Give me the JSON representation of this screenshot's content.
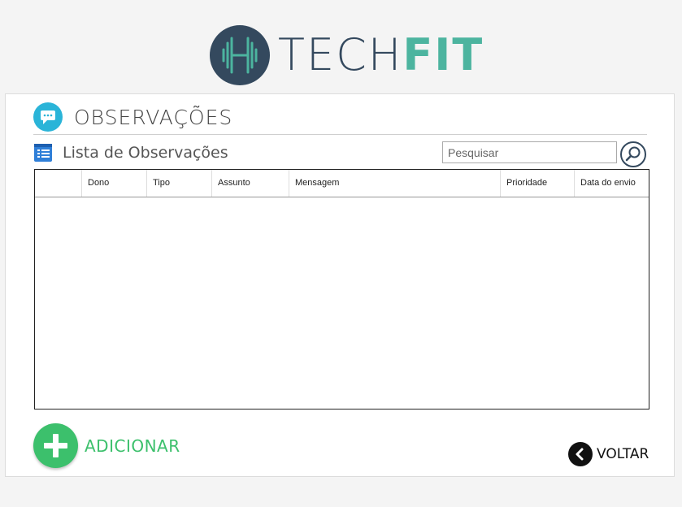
{
  "brand": {
    "tech": "TECH",
    "fit": "FIT",
    "colors": {
      "dark": "#34495e",
      "teal": "#4cb49f"
    }
  },
  "section": {
    "title": "OBSERVAÇÕES",
    "icon": "chat-bubble-icon"
  },
  "list": {
    "title": "Lista de Observações",
    "icon": "list-icon"
  },
  "search": {
    "placeholder": "Pesquisar",
    "value": "",
    "icon": "search-icon"
  },
  "table": {
    "columns": [
      "",
      "Dono",
      "Tipo",
      "Assunto",
      "Mensagem",
      "Prioridade",
      "Data do envio"
    ],
    "rows": []
  },
  "actions": {
    "add_label": "ADICIONAR",
    "add_icon": "plus-icon",
    "back_label": "VOLTAR",
    "back_icon": "chevron-left-icon"
  },
  "colors": {
    "accent_green": "#3cc06c",
    "accent_blue": "#2ab4d8"
  }
}
